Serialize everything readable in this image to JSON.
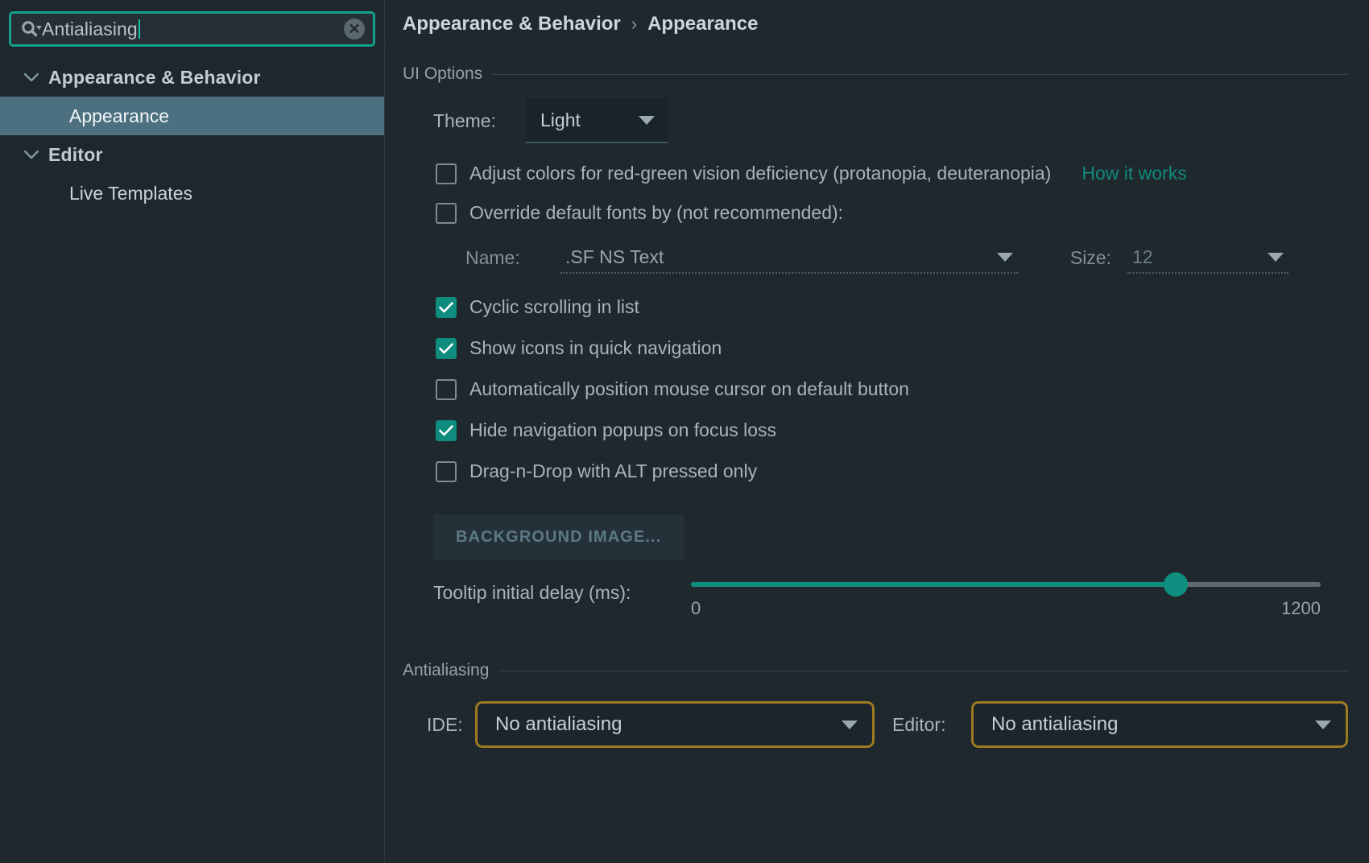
{
  "search": {
    "value": "Antialiasing",
    "icon": "search-icon",
    "clear_icon": "clear-icon"
  },
  "sidebar": {
    "items": [
      {
        "label": "Appearance & Behavior",
        "type": "group",
        "expanded": true,
        "selected": false
      },
      {
        "label": "Appearance",
        "type": "child",
        "selected": true
      },
      {
        "label": "Editor",
        "type": "group",
        "expanded": true,
        "selected": false
      },
      {
        "label": "Live Templates",
        "type": "child",
        "selected": false
      }
    ]
  },
  "breadcrumb": {
    "root": "Appearance & Behavior",
    "separator": "›",
    "current": "Appearance"
  },
  "ui_options": {
    "section_title": "UI Options",
    "theme": {
      "label": "Theme:",
      "value": "Light"
    },
    "checkboxes": [
      {
        "label": "Adjust colors for red-green vision deficiency (protanopia, deuteranopia)",
        "checked": false,
        "link": "How it works"
      },
      {
        "label": "Override default fonts by (not recommended):",
        "checked": false
      },
      {
        "label": "Cyclic scrolling in list",
        "checked": true
      },
      {
        "label": "Show icons in quick navigation",
        "checked": true
      },
      {
        "label": "Automatically position mouse cursor on default button",
        "checked": false
      },
      {
        "label": "Hide navigation popups on focus loss",
        "checked": true
      },
      {
        "label": "Drag-n-Drop with ALT pressed only",
        "checked": false
      }
    ],
    "font_name": {
      "label": "Name:",
      "value": ".SF NS Text"
    },
    "font_size": {
      "label": "Size:",
      "value": "12"
    },
    "background_image_button": "BACKGROUND IMAGE...",
    "tooltip_delay": {
      "label": "Tooltip initial delay (ms):",
      "min": "0",
      "max": "1200",
      "value": 925,
      "percent": 77
    }
  },
  "antialiasing": {
    "section_title": "Antialiasing",
    "ide": {
      "label": "IDE:",
      "value": "No antialiasing"
    },
    "editor": {
      "label": "Editor:",
      "value": "No antialiasing"
    }
  },
  "colors": {
    "background": "#1e282d",
    "sidebar_selection": "#4c707f",
    "accent_teal": "#0f8c7e",
    "focus_gold": "#9d7b20",
    "link": "#12897c"
  }
}
